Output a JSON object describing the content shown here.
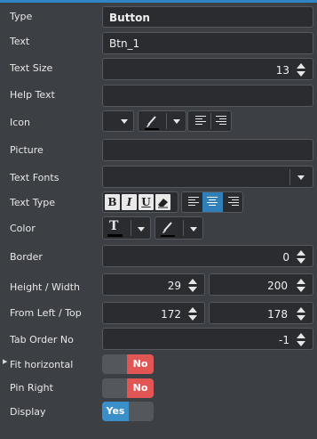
{
  "rows": {
    "type": {
      "label": "Type",
      "value": "Button"
    },
    "text": {
      "label": "Text",
      "value": "Btn_1"
    },
    "text_size": {
      "label": "Text Size",
      "value": "13"
    },
    "help_text": {
      "label": "Help Text",
      "value": ""
    },
    "icon": {
      "label": "Icon"
    },
    "picture": {
      "label": "Picture",
      "value": ""
    },
    "text_fonts": {
      "label": "Text Fonts",
      "value": ""
    },
    "text_type": {
      "label": "Text Type",
      "bold": "B",
      "italic": "I",
      "underline": "U",
      "active_align": "center"
    },
    "color": {
      "label": "Color",
      "text_glyph": "T",
      "text_color": "#000000",
      "fill_color": "#000000"
    },
    "border": {
      "label": "Border",
      "value": "0"
    },
    "height_width": {
      "label": "Height / Width",
      "height": "29",
      "width": "200"
    },
    "from_left_top": {
      "label": "From Left / Top",
      "left": "172",
      "top": "178"
    },
    "tab_order": {
      "label": "Tab Order No",
      "value": "-1"
    },
    "fit_horizontal": {
      "label": "Fit horizontal",
      "value": "No"
    },
    "pin_right": {
      "label": "Pin Right",
      "value": "No"
    },
    "display": {
      "label": "Display",
      "value": "Yes"
    }
  },
  "colors": {
    "accent": "#2f86c4",
    "off": "#e25555",
    "on": "#3a8fc8",
    "panel": "#3c3f44",
    "field": "#2a2c30"
  }
}
